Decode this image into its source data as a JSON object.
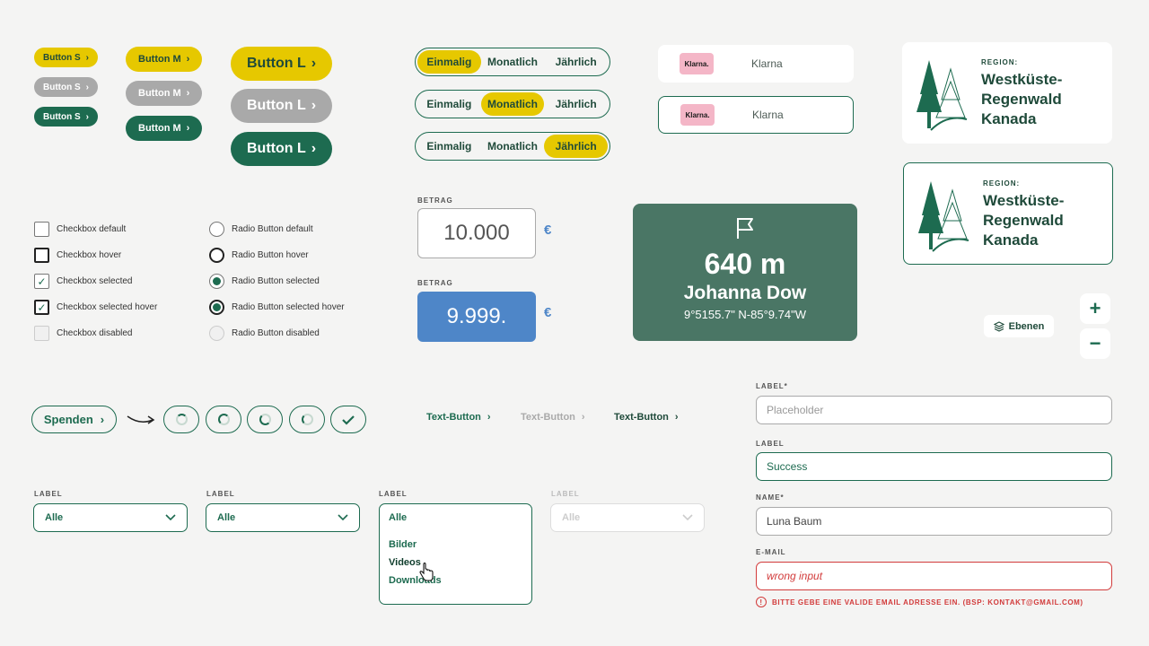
{
  "buttons": {
    "small": "Button S",
    "medium": "Button M",
    "large": "Button L"
  },
  "frequency": [
    "Einmalig",
    "Monatlich",
    "Jährlich"
  ],
  "klarna": {
    "logo": "Klarna.",
    "label": "Klarna"
  },
  "region": {
    "label": "REGION:",
    "line1": "Westküste-",
    "line2": "Regenwald",
    "line3": "Kanada"
  },
  "checkboxes": [
    "Checkbox default",
    "Checkbox hover",
    "Checkbox selected",
    "Checkbox selected hover",
    "Checkbox disabled"
  ],
  "radios": [
    "Radio Button default",
    "Radio Button hover",
    "Radio Button selected",
    "Radio Button selected hover",
    "Radio Button disabled"
  ],
  "amount": {
    "label": "BETRAG",
    "value_default": "10.000",
    "value_active": "9.999.",
    "currency": "€"
  },
  "map_info": {
    "distance": "640 m",
    "name": "Johanna Dow",
    "coords": "9°5155.7\" N-85°9.74\"W"
  },
  "map_controls": {
    "zoom_in": "+",
    "zoom_out": "−",
    "layers": "Ebenen"
  },
  "donate": {
    "label": "Spenden"
  },
  "text_button": "Text-Button",
  "selects": {
    "label": "LABEL",
    "value": "Alle",
    "options": [
      "Bilder",
      "Videos",
      "Downloads"
    ]
  },
  "form": {
    "f1_label": "LABEL*",
    "f1_placeholder": "Placeholder",
    "f2_label": "LABEL",
    "f2_value": "Success",
    "f3_label": "NAME*",
    "f3_value": "Luna Baum",
    "f4_label": "E-MAIL",
    "f4_value": "wrong input",
    "error": "BITTE GEBE EINE VALIDE EMAIL ADRESSE EIN. (BSP: KONTAKT@GMAIL.COM)"
  },
  "colors": {
    "primary": "#1d6b50",
    "accent": "#e6c800",
    "disabled": "#a9a9a9",
    "active_blue": "#4e86c8",
    "error": "#d23b3b",
    "klarna_pink": "#f4b6c7"
  },
  "icons": [
    "chevron-right-icon",
    "flag-icon",
    "layers-icon",
    "tree-icon",
    "arrow-icon",
    "spinner-icon",
    "check-icon",
    "chevron-down-icon",
    "hand-cursor-icon",
    "error-icon"
  ]
}
